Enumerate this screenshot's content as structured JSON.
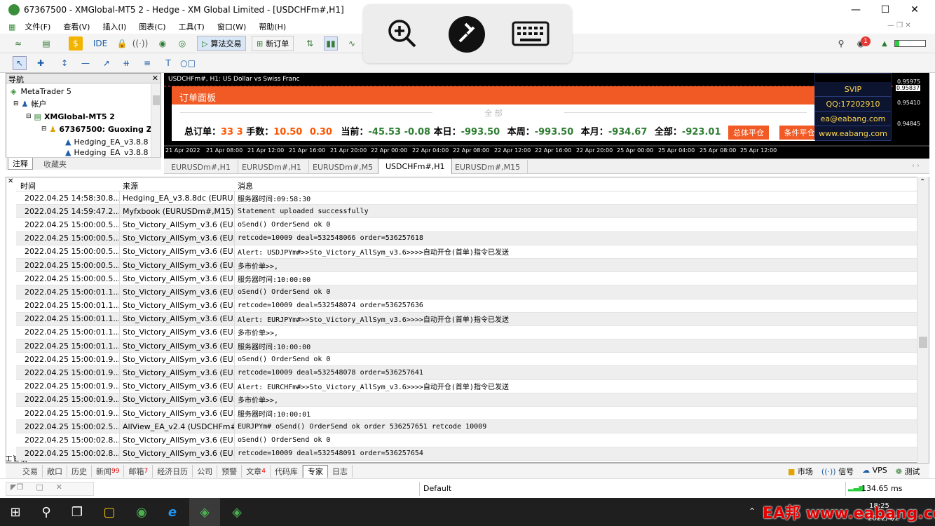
{
  "window": {
    "title": "67367500 - XMGlobal-MT5 2 - Hedge - XM Global Limited - [USDCHFm#,H1]"
  },
  "menu": [
    "文件(F)",
    "查看(V)",
    "插入(I)",
    "图表(C)",
    "工具(T)",
    "窗口(W)",
    "帮助(H)"
  ],
  "toolbar": {
    "ide": "IDE",
    "algo": "算法交易",
    "new_order": "新订单"
  },
  "navigator": {
    "title": "导航",
    "items": [
      "MetaTrader 5",
      "帐户",
      "XMGlobal-MT5 2",
      "67367500: Guoxing Zh",
      "Hedging_EA_v3.8.8",
      "Hedging_EA_v3.8.8"
    ],
    "tabs": [
      "注释",
      "收藏夹"
    ]
  },
  "chart": {
    "label": "USDCHFm#, H1:  US Dollar vs Swiss Franc",
    "prices": [
      "0.95975",
      "0.95837",
      "0.95410",
      "0.94845"
    ],
    "time_axis": [
      "21 Apr 2022",
      "21 Apr 08:00",
      "21 Apr 12:00",
      "21 Apr 16:00",
      "21 Apr 20:00",
      "22 Apr 00:00",
      "22 Apr 04:00",
      "22 Apr 08:00",
      "22 Apr 12:00",
      "22 Apr 16:00",
      "22 Apr 20:00",
      "25 Apr 00:00",
      "25 Apr 04:00",
      "25 Apr 08:00",
      "25 Apr 12:00"
    ]
  },
  "order_panel": {
    "title": "订单面板",
    "section": "全 部",
    "total_label": "总订单：",
    "total_a": "33",
    "total_b": "3",
    "lots_label": "手数：",
    "lots_a": "10.50",
    "lots_b": "0.30",
    "current_label": "当前：",
    "current_a": "-45.53",
    "current_b": "-0.08",
    "today_label": "本日：",
    "today": "-993.50",
    "week_label": "本周：",
    "week": "-993.50",
    "month_label": "本月：",
    "month": "-934.67",
    "all_label": "全部：",
    "all": "-923.01",
    "btn_close_all": "总体平仓",
    "btn_cond_close": "条件平仓"
  },
  "vip_box": [
    "SVIP",
    "QQ:17202910",
    "ea@eabang.com",
    "www.eabang.com"
  ],
  "chart_tabs": [
    "EURUSDm#,H1",
    "EURUSDm#,H1",
    "EURUSDm#,M5",
    "USDCHFm#,H1",
    "EURUSDm#,M15"
  ],
  "log": {
    "headers": {
      "time": "时间",
      "source": "来源",
      "message": "消息"
    },
    "rows": [
      {
        "t": "2022.04.25 14:58:30.8...",
        "s": "Hedging_EA_v3.8.8dc (EURU...",
        "m": "服务器时间:09:58:30"
      },
      {
        "t": "2022.04.25 14:59:47.2...",
        "s": "Myfxbook (EURUSDm#,M15)",
        "m": "Statement uploaded successfully"
      },
      {
        "t": "2022.04.25 15:00:00.5...",
        "s": "Sto_Victory_AllSym_v3.6 (EU...",
        "m": "oSend() OrderSend ok 0"
      },
      {
        "t": "2022.04.25 15:00:00.5...",
        "s": "Sto_Victory_AllSym_v3.6 (EU...",
        "m": "retcode=10009  deal=532548066  order=536257618"
      },
      {
        "t": "2022.04.25 15:00:00.5...",
        "s": "Sto_Victory_AllSym_v3.6 (EU...",
        "m": "Alert: USDJPYm#>>Sto_Victory_AllSym_v3.6>>>>自动开仓(首单)指令已发送"
      },
      {
        "t": "2022.04.25 15:00:00.5...",
        "s": "Sto_Victory_AllSym_v3.6 (EU...",
        "m": "多市价单>>,"
      },
      {
        "t": "2022.04.25 15:00:00.5...",
        "s": "Sto_Victory_AllSym_v3.6 (EU...",
        "m": "服务器时间:10:00:00"
      },
      {
        "t": "2022.04.25 15:00:01.1...",
        "s": "Sto_Victory_AllSym_v3.6 (EU...",
        "m": "oSend() OrderSend ok 0"
      },
      {
        "t": "2022.04.25 15:00:01.1...",
        "s": "Sto_Victory_AllSym_v3.6 (EU...",
        "m": "retcode=10009  deal=532548074  order=536257636"
      },
      {
        "t": "2022.04.25 15:00:01.1...",
        "s": "Sto_Victory_AllSym_v3.6 (EU...",
        "m": "Alert: EURJPYm#>>Sto_Victory_AllSym_v3.6>>>>自动开仓(首单)指令已发送"
      },
      {
        "t": "2022.04.25 15:00:01.1...",
        "s": "Sto_Victory_AllSym_v3.6 (EU...",
        "m": "多市价单>>,"
      },
      {
        "t": "2022.04.25 15:00:01.1...",
        "s": "Sto_Victory_AllSym_v3.6 (EU...",
        "m": "服务器时间:10:00:00"
      },
      {
        "t": "2022.04.25 15:00:01.9...",
        "s": "Sto_Victory_AllSym_v3.6 (EU...",
        "m": "oSend() OrderSend ok 0"
      },
      {
        "t": "2022.04.25 15:00:01.9...",
        "s": "Sto_Victory_AllSym_v3.6 (EU...",
        "m": "retcode=10009  deal=532548078  order=536257641"
      },
      {
        "t": "2022.04.25 15:00:01.9...",
        "s": "Sto_Victory_AllSym_v3.6 (EU...",
        "m": "Alert: EURCHFm#>>Sto_Victory_AllSym_v3.6>>>>自动开仓(首单)指令已发送"
      },
      {
        "t": "2022.04.25 15:00:01.9...",
        "s": "Sto_Victory_AllSym_v3.6 (EU...",
        "m": "多市价单>>,"
      },
      {
        "t": "2022.04.25 15:00:01.9...",
        "s": "Sto_Victory_AllSym_v3.6 (EU...",
        "m": "服务器时间:10:00:01"
      },
      {
        "t": "2022.04.25 15:00:02.5...",
        "s": "AllView_EA_v2.4 (USDCHFm#...",
        "m": "EURJPYm# oSend() OrderSend ok order 536257651 retcode 10009"
      },
      {
        "t": "2022.04.25 15:00:02.8...",
        "s": "Sto_Victory_AllSym_v3.6 (EU...",
        "m": "oSend() OrderSend ok 0"
      },
      {
        "t": "2022.04.25 15:00:02.8...",
        "s": "Sto_Victory_AllSym_v3.6 (EU...",
        "m": "retcode=10009  deal=532548091  order=536257654"
      }
    ]
  },
  "bottom_tabs": [
    {
      "label": "交易",
      "badge": ""
    },
    {
      "label": "敞口",
      "badge": ""
    },
    {
      "label": "历史",
      "badge": ""
    },
    {
      "label": "新闻",
      "badge": "99"
    },
    {
      "label": "邮箱",
      "badge": "7"
    },
    {
      "label": "经济日历",
      "badge": ""
    },
    {
      "label": "公司",
      "badge": ""
    },
    {
      "label": "预警",
      "badge": ""
    },
    {
      "label": "文章",
      "badge": "4"
    },
    {
      "label": "代码库",
      "badge": ""
    },
    {
      "label": "专家",
      "badge": ""
    },
    {
      "label": "日志",
      "badge": ""
    }
  ],
  "bottom_right": {
    "market": "市场",
    "signals": "信号",
    "vps": "VPS",
    "tester": "测试"
  },
  "status": {
    "profile": "Default",
    "ping": "134.65 ms"
  },
  "toolbox_label": "工具箱",
  "notify_count": "1",
  "watermark": "EA邦 www.eabang.com",
  "taskbar": {
    "time": "18:25",
    "date": "2022/4/2"
  }
}
